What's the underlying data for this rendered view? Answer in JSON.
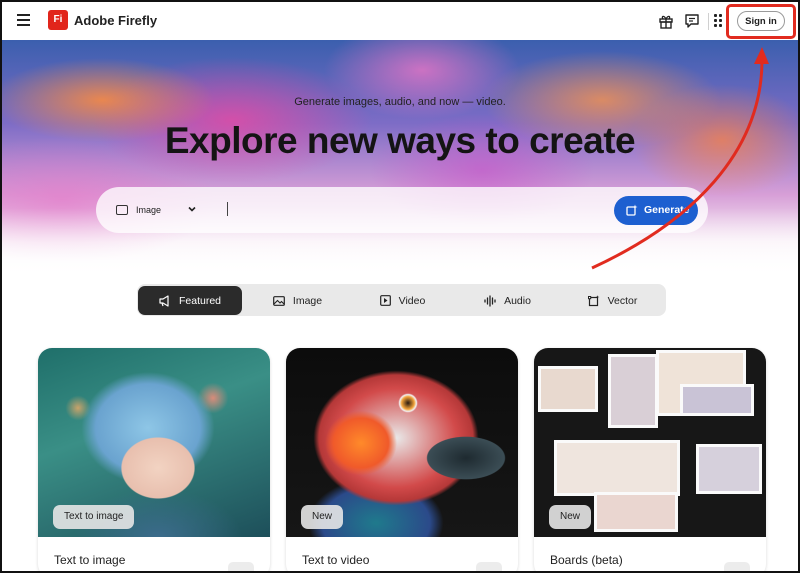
{
  "header": {
    "app_logo": "Fi",
    "app_title": "Adobe Firefly",
    "sign_in_label": "Sign in"
  },
  "hero": {
    "subtitle": "Generate images, audio, and now — video.",
    "title": "Explore new ways to create",
    "media_type": "Image",
    "prompt_value": "",
    "generate_label": "Generate"
  },
  "tabs": [
    {
      "label": "Featured",
      "icon": "megaphone-icon",
      "active": true
    },
    {
      "label": "Image",
      "icon": "image-icon",
      "active": false
    },
    {
      "label": "Video",
      "icon": "video-icon",
      "active": false
    },
    {
      "label": "Audio",
      "icon": "audio-icon",
      "active": false
    },
    {
      "label": "Vector",
      "icon": "vector-icon",
      "active": false
    }
  ],
  "cards": [
    {
      "badge": "Text to image",
      "title": "Text to image"
    },
    {
      "badge": "New",
      "title": "Text to video"
    },
    {
      "badge": "New",
      "title": "Boards (beta)"
    }
  ],
  "colors": {
    "accent": "#1d5fd0",
    "logo": "#e1251b",
    "annotation": "#e12b1f"
  }
}
